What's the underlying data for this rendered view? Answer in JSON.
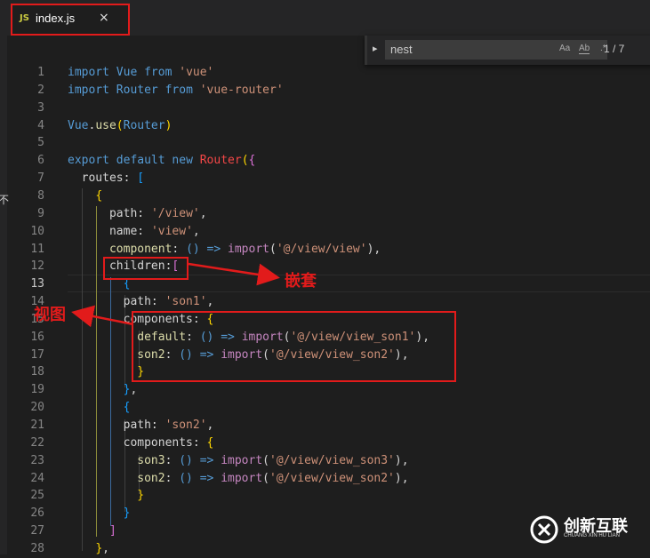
{
  "tab": {
    "icon": "JS",
    "name": "index.js",
    "close": "×"
  },
  "find": {
    "query": "nest",
    "match_case": "Aa",
    "whole_word": "Ab",
    "regex": ".*",
    "count": "1 / 7"
  },
  "side_glyph": "不",
  "line_numbers": [
    "1",
    "2",
    "3",
    "4",
    "5",
    "6",
    "7",
    "8",
    "9",
    "10",
    "11",
    "12",
    "13",
    "14",
    "15",
    "16",
    "17",
    "18",
    "19",
    "20",
    "21",
    "22",
    "23",
    "24",
    "25",
    "26",
    "27",
    "28"
  ],
  "code": [
    [
      [
        "import ",
        "#569cd6"
      ],
      [
        "Vue ",
        "#569cd6"
      ],
      [
        "from ",
        "#569cd6"
      ],
      [
        "'vue'",
        "#ce9178"
      ]
    ],
    [
      [
        "import ",
        "#569cd6"
      ],
      [
        "Router ",
        "#569cd6"
      ],
      [
        "from ",
        "#569cd6"
      ],
      [
        "'vue-router'",
        "#ce9178"
      ]
    ],
    [],
    [
      [
        "Vue",
        "#569cd6"
      ],
      [
        ".",
        "#d4d4d4"
      ],
      [
        "use",
        "#dcdcaa"
      ],
      [
        "(",
        "#ffd700"
      ],
      [
        "Router",
        "#569cd6"
      ],
      [
        ")",
        "#ffd700"
      ]
    ],
    [],
    [
      [
        "export ",
        "#569cd6"
      ],
      [
        "default ",
        "#569cd6"
      ],
      [
        "new ",
        "#569cd6"
      ],
      [
        "Router",
        "#f44747"
      ],
      [
        "(",
        "#ffd700"
      ],
      [
        "{",
        "#da70d6"
      ]
    ],
    [
      [
        "  routes",
        "#d4d4d4"
      ],
      [
        ": ",
        "#d4d4d4"
      ],
      [
        "[",
        "#179fff"
      ]
    ],
    [
      [
        "    ",
        "#d4d4d4"
      ],
      [
        "{",
        "#ffd700"
      ]
    ],
    [
      [
        "      path",
        "#d4d4d4"
      ],
      [
        ": ",
        "#d4d4d4"
      ],
      [
        "'/view'",
        "#ce9178"
      ],
      [
        ",",
        "#d4d4d4"
      ]
    ],
    [
      [
        "      name",
        "#d4d4d4"
      ],
      [
        ": ",
        "#d4d4d4"
      ],
      [
        "'view'",
        "#ce9178"
      ],
      [
        ",",
        "#d4d4d4"
      ]
    ],
    [
      [
        "      component",
        "#dcdcaa"
      ],
      [
        ": ",
        "#d4d4d4"
      ],
      [
        "() ",
        "#569cd6"
      ],
      [
        "=> ",
        "#569cd6"
      ],
      [
        "import",
        "#c586c0"
      ],
      [
        "(",
        "#d4d4d4"
      ],
      [
        "'@/view/view'",
        "#ce9178"
      ],
      [
        "),",
        "#d4d4d4"
      ]
    ],
    [
      [
        "      children",
        "#d4d4d4"
      ],
      [
        ":",
        "#d4d4d4"
      ],
      [
        "[",
        "#da70d6"
      ]
    ],
    [
      [
        "        ",
        "#d4d4d4"
      ],
      [
        "{",
        "#179fff"
      ]
    ],
    [
      [
        "        path",
        "#d4d4d4"
      ],
      [
        ": ",
        "#d4d4d4"
      ],
      [
        "'son1'",
        "#ce9178"
      ],
      [
        ",",
        "#d4d4d4"
      ]
    ],
    [
      [
        "        components",
        "#d4d4d4"
      ],
      [
        ": ",
        "#d4d4d4"
      ],
      [
        "{",
        "#ffd700"
      ]
    ],
    [
      [
        "          default",
        "#dcdcaa"
      ],
      [
        ": ",
        "#d4d4d4"
      ],
      [
        "() ",
        "#569cd6"
      ],
      [
        "=> ",
        "#569cd6"
      ],
      [
        "import",
        "#c586c0"
      ],
      [
        "(",
        "#d4d4d4"
      ],
      [
        "'@/view/view_son1'",
        "#ce9178"
      ],
      [
        "),",
        "#d4d4d4"
      ]
    ],
    [
      [
        "          son2",
        "#dcdcaa"
      ],
      [
        ": ",
        "#d4d4d4"
      ],
      [
        "() ",
        "#569cd6"
      ],
      [
        "=> ",
        "#569cd6"
      ],
      [
        "import",
        "#c586c0"
      ],
      [
        "(",
        "#d4d4d4"
      ],
      [
        "'@/view/view_son2'",
        "#ce9178"
      ],
      [
        "),",
        "#d4d4d4"
      ]
    ],
    [
      [
        "          ",
        "#d4d4d4"
      ],
      [
        "}",
        "#ffd700"
      ]
    ],
    [
      [
        "        ",
        "#d4d4d4"
      ],
      [
        "}",
        "#179fff"
      ],
      [
        ",",
        "#d4d4d4"
      ]
    ],
    [
      [
        "        ",
        "#d4d4d4"
      ],
      [
        "{",
        "#179fff"
      ]
    ],
    [
      [
        "        path",
        "#d4d4d4"
      ],
      [
        ": ",
        "#d4d4d4"
      ],
      [
        "'son2'",
        "#ce9178"
      ],
      [
        ",",
        "#d4d4d4"
      ]
    ],
    [
      [
        "        components",
        "#d4d4d4"
      ],
      [
        ": ",
        "#d4d4d4"
      ],
      [
        "{",
        "#ffd700"
      ]
    ],
    [
      [
        "          son3",
        "#dcdcaa"
      ],
      [
        ": ",
        "#d4d4d4"
      ],
      [
        "() ",
        "#569cd6"
      ],
      [
        "=> ",
        "#569cd6"
      ],
      [
        "import",
        "#c586c0"
      ],
      [
        "(",
        "#d4d4d4"
      ],
      [
        "'@/view/view_son3'",
        "#ce9178"
      ],
      [
        "),",
        "#d4d4d4"
      ]
    ],
    [
      [
        "          son2",
        "#dcdcaa"
      ],
      [
        ": ",
        "#d4d4d4"
      ],
      [
        "() ",
        "#569cd6"
      ],
      [
        "=> ",
        "#569cd6"
      ],
      [
        "import",
        "#c586c0"
      ],
      [
        "(",
        "#d4d4d4"
      ],
      [
        "'@/view/view_son2'",
        "#ce9178"
      ],
      [
        "),",
        "#d4d4d4"
      ]
    ],
    [
      [
        "          ",
        "#d4d4d4"
      ],
      [
        "}",
        "#ffd700"
      ]
    ],
    [
      [
        "        ",
        "#d4d4d4"
      ],
      [
        "}",
        "#179fff"
      ]
    ],
    [
      [
        "      ",
        "#d4d4d4"
      ],
      [
        "]",
        "#da70d6"
      ]
    ],
    [
      [
        "    ",
        "#d4d4d4"
      ],
      [
        "}",
        "#ffd700"
      ],
      [
        ",",
        "#d4d4d4"
      ]
    ]
  ],
  "current_line": "13",
  "annotations": {
    "nesting": "嵌套",
    "views": "视图"
  },
  "watermark": {
    "name": "创新互联",
    "sub": "CHUANG XIN HU LIAN"
  },
  "colors": {
    "highlight": "#e21b1b",
    "keyword": "#569cd6",
    "string": "#ce9178"
  }
}
